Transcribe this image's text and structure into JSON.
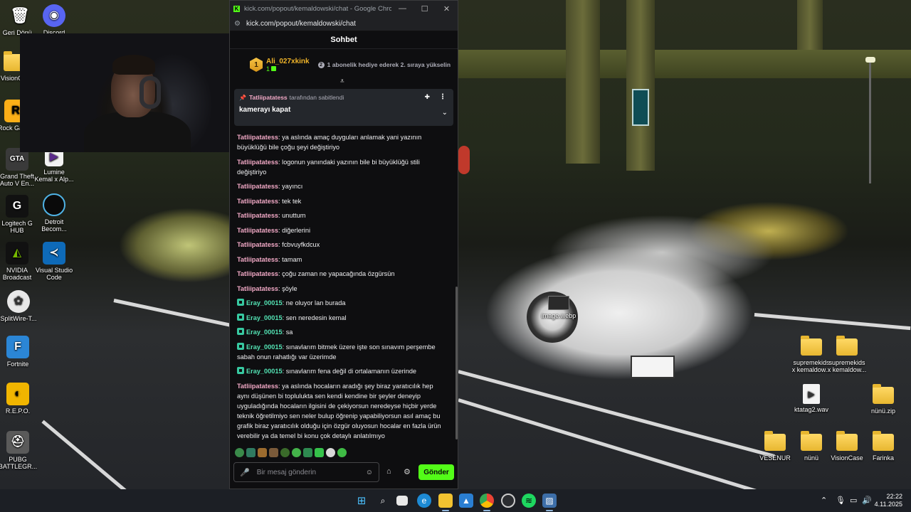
{
  "window": {
    "title": "kick.com/popout/kemaldowski/chat - Google Chrome",
    "logo_letter": "K",
    "controls": {
      "minimize": "—",
      "maximize": "☐",
      "close": "✕"
    }
  },
  "address_bar": {
    "url": "kick.com/popout/kemaldowski/chat"
  },
  "chat": {
    "header": "Sohbet",
    "leaderboard": {
      "rank": "1",
      "username": "Ali_027xkink",
      "gift_count": "1",
      "info_num": "2",
      "info_text": "1 abonelik hediye ederek 2. sıraya yükselin"
    },
    "pinned": {
      "pinned_by": "Tatliipatatess",
      "pinned_suffix": "tarafından sabitlendi",
      "message": "kamerayı kapat"
    },
    "messages": [
      {
        "user": "Tatliipatatess",
        "text": "ya aslında amaç duyguları anlamak yani yazının büyüklüğü bile çoğu şeyi değiştiriyo"
      },
      {
        "user": "Tatliipatatess",
        "text": "logonun yanındaki yazının bile bi büyüklüğü stili değiştiriyo"
      },
      {
        "user": "Tatliipatatess",
        "text": "yayıncı"
      },
      {
        "user": "Tatliipatatess",
        "text": "tek tek"
      },
      {
        "user": "Tatliipatatess",
        "text": "unuttum"
      },
      {
        "user": "Tatliipatatess",
        "text": "diğerlerini"
      },
      {
        "user": "Tatliipatatess",
        "text": "fcbvuyfkdcux"
      },
      {
        "user": "Tatliipatatess",
        "text": "tamam"
      },
      {
        "user": "Tatliipatatess",
        "text": "çoğu zaman ne yapacağında özgürsün"
      },
      {
        "user": "Tatliipatatess",
        "text": "şöyle"
      },
      {
        "user": "Eray_00015",
        "text": "ne oluyor lan burada"
      },
      {
        "user": "Eray_00015",
        "text": "sen neredesin kemal"
      },
      {
        "user": "Eray_00015",
        "text": "sa"
      },
      {
        "user": "Eray_00015",
        "text": "sınavlarım bitmek üzere işte son sınavım perşembe sabah onun rahatlığı var üzerimde"
      },
      {
        "user": "Eray_00015",
        "text": "sınavlarım fena değil di ortalamanın üzerinde"
      },
      {
        "user": "Tatliipatatess",
        "text": "ya aslında hocaların aradığı şey biraz yaratıcılık hep aynı düşünen bi toplulukta sen kendi kendine bir şeyler deneyip uyguladığında hocaların ilgisini de çekiyorsun neredeyse hiçbir yerde teknik öğretilmiyo sen neler bulup öğrenip yapabiliyorsun asıl amaç bu grafik biraz yaratıcılık olduğu için özgür oluyosun hocalar en fazla ürün verebilir ya da temel bi konu çok detaylı anlatılmıyo"
      }
    ],
    "composer": {
      "placeholder": "Bir mesaj gönderin",
      "send_label": "Gönder"
    },
    "colors": {
      "accent": "#53fc18",
      "user_pink": "#f2a9c6",
      "user_green": "#53e3b4",
      "background": "#0e0e10"
    }
  },
  "desktop_icons": [
    {
      "label": "Geri Dönü..."
    },
    {
      "label": "Discord"
    },
    {
      "label": "VisionC..."
    },
    {
      "label": "Rock Gam..."
    },
    {
      "label": "Grand Theft Auto V En..."
    },
    {
      "label": "Lumine Kemal x Alp..."
    },
    {
      "label": "Logitech G HUB"
    },
    {
      "label": "Detroit Becom..."
    },
    {
      "label": "NVIDIA Broadcast"
    },
    {
      "label": "Visual Studio Code"
    },
    {
      "label": "SplitWire-T..."
    },
    {
      "label": "Fortnite"
    },
    {
      "label": "R.E.P.O."
    },
    {
      "label": "PUBG BATTLEGR..."
    },
    {
      "label": "image.webp"
    },
    {
      "label": "supremekids x kemaldow..."
    },
    {
      "label": "supremekids x kemaldow..."
    },
    {
      "label": "ktatag2.wav"
    },
    {
      "label": "nünü.zip"
    },
    {
      "label": "VESENUR"
    },
    {
      "label": "nünü"
    },
    {
      "label": "VisionCase"
    },
    {
      "label": "Farinka"
    }
  ],
  "taskbar": {
    "time": "22:22",
    "date": "4.11.2025"
  }
}
